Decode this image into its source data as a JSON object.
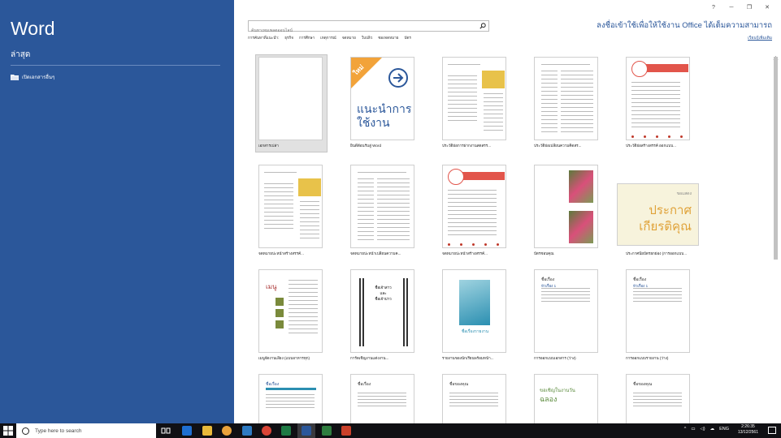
{
  "sidebar": {
    "app_title": "Word",
    "recent_heading": "ล่าสุด",
    "open_other": "เปิดเอกสารอื่นๆ"
  },
  "header": {
    "search_placeholder": "ค้นหาเทมเพลตออนไลน์",
    "suggested": [
      "การค้นหาที่แนะนำ:",
      "ธุรกิจ",
      "การศึกษา",
      "เหตุการณ์",
      "จดหมาย",
      "ใบปลิว",
      "ซองจดหมาย",
      "บัตร"
    ],
    "signin_text": "ลงชื่อเข้าใช้เพื่อให้ใช้งาน Office ได้เต็มความสามารถ",
    "signin_link": "เรียนรู้เพิ่มเติม",
    "window_controls": [
      "?",
      "─",
      "❐",
      "✕"
    ]
  },
  "templates": [
    {
      "label": "เอกสารเปล่า",
      "kind": "blank"
    },
    {
      "label": "ยินดีต้อนรับสู่ Word",
      "kind": "tour",
      "tour_badge": "ใหม่",
      "tour_text": "แนะนำการใช้งาน"
    },
    {
      "label": "ประวัติย่อการฝากงานสดสรร...",
      "kind": "resume-yellow"
    },
    {
      "label": "ประวัติย่อเปลี่ยนความคิดสร...",
      "kind": "resume-plain"
    },
    {
      "label": "ประวัติย่อสร้างสรรค์ ออกแบบ...",
      "kind": "resume-red"
    },
    {
      "label": "จดหมายปะหน้าสร้างสรรค์...",
      "kind": "resume-yellow"
    },
    {
      "label": "จดหมายปะหน้าเปลี่ยนความค...",
      "kind": "resume-plain"
    },
    {
      "label": "จดหมายปะหน้าสร้างสรรค์...",
      "kind": "resume-red"
    },
    {
      "label": "บัตรชอบคุณ",
      "kind": "flowers"
    },
    {
      "label": "ประกาศนียบัตรยกย่อง (การออกแบบ...",
      "kind": "certificate",
      "cert_small": "ขอแสดง",
      "cert_big1": "ประกาศ",
      "cert_big2": "เกียรติคุณ"
    },
    {
      "label": "เมนูจัดงานเลี้ยง (แบบอาหารทุก)",
      "kind": "menu",
      "menu_title": "เมนู"
    },
    {
      "label": "การ์ดเชิญงานแต่งงาน...",
      "kind": "wedding",
      "wed1": "ชื่อเจ้าสาว",
      "wed2": "และ",
      "wed3": "ชื่อเจ้าบ่าว"
    },
    {
      "label": "รายงานของนักเรียนพร้อมหน้า...",
      "kind": "report",
      "report_title": "ชื่อเรื่องรายงาน"
    },
    {
      "label": "การออกแบบเอกสาร (ว่าง)",
      "kind": "plain-doc",
      "doc_title": "ชื่อเรื่อง",
      "doc_h": "หัวเรื่อง 1"
    },
    {
      "label": "การออกแบบรายงาน (ว่าง)",
      "kind": "plain-doc",
      "doc_title": "ชื่อเรื่อง",
      "doc_h": "หัวเรื่อง 1"
    },
    {
      "label": "",
      "kind": "blue-doc",
      "doc_title": "ชื่อเรื่อง"
    },
    {
      "label": "",
      "kind": "plain-doc",
      "doc_title": "ชื่อเรื่อง",
      "doc_h": ""
    },
    {
      "label": "",
      "kind": "plain-doc",
      "doc_title": "ชื่อของคุณ",
      "doc_h": ""
    },
    {
      "label": "",
      "kind": "event",
      "event_line1": "ขอเชิญในงานวัน",
      "event_line2": "ฉลอง"
    },
    {
      "label": "",
      "kind": "plain-doc",
      "doc_title": "ชื่อของคุณ",
      "doc_h": ""
    }
  ],
  "taskbar": {
    "search_placeholder": "Type here to search",
    "lang": "ENG",
    "time": "2:26:35",
    "date": "13/12/2561"
  },
  "colors": {
    "accent": "#2b579a",
    "taskbar": "#101014"
  }
}
